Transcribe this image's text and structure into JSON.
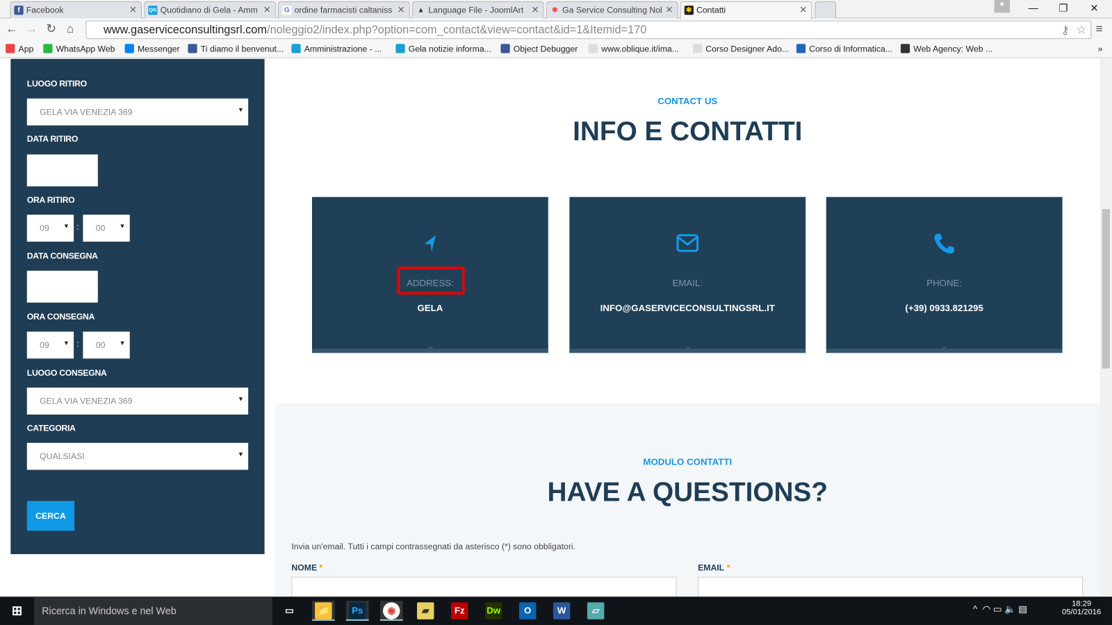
{
  "browser": {
    "tabs": [
      {
        "title": "Facebook",
        "fav": "f",
        "color": "#3b5998"
      },
      {
        "title": "Quotidiano di Gela - Amm",
        "fav": "QG",
        "color": "#1aa0d8"
      },
      {
        "title": "ordine farmacisti caltaniss",
        "fav": "G",
        "color": "#4285f4"
      },
      {
        "title": "Language File - JoomlArt",
        "fav": "▲",
        "color": "#333"
      },
      {
        "title": "Ga Service Consulting Nol",
        "fav": "✱",
        "color": "#e44"
      },
      {
        "title": "Contatti",
        "fav": "✱",
        "color": "#222"
      }
    ],
    "url_domain": "www.gaserviceconsultingsrl.com",
    "url_path": "/noleggio2/index.php?option=com_contact&view=contact&id=1&Itemid=170",
    "bookmarks": [
      {
        "label": "App",
        "color": "#e44"
      },
      {
        "label": "WhatsApp Web",
        "color": "#2db742"
      },
      {
        "label": "Messenger",
        "color": "#0084ff"
      },
      {
        "label": "Ti diamo il benvenut...",
        "color": "#3b5998"
      },
      {
        "label": "Amministrazione - ...",
        "color": "#1aa0d8"
      },
      {
        "label": "Gela notizie informa...",
        "color": "#1aa0d8"
      },
      {
        "label": "Object Debugger",
        "color": "#3b5998"
      },
      {
        "label": "www.oblique.it/ima...",
        "color": "#ddd"
      },
      {
        "label": "Corso Designer Ado...",
        "color": "#ddd"
      },
      {
        "label": "Corso di Informatica...",
        "color": "#2266bb"
      },
      {
        "label": "Web Agency: Web ...",
        "color": "#333"
      }
    ]
  },
  "sidebar": {
    "luogo_ritiro_label": "LUOGO RITIRO",
    "luogo_ritiro_value": "GELA VIA VENEZIA 369",
    "data_ritiro_label": "DATA RITIRO",
    "ora_ritiro_label": "ORA RITIRO",
    "ora_ritiro_h": "09",
    "ora_ritiro_m": "00",
    "data_consegna_label": "DATA CONSEGNA",
    "ora_consegna_label": "ORA CONSEGNA",
    "ora_consegna_h": "09",
    "ora_consegna_m": "00",
    "luogo_consegna_label": "LUOGO CONSEGNA",
    "luogo_consegna_value": "GELA VIA VENEZIA 369",
    "categoria_label": "CATEGORIA",
    "categoria_value": "QUALSIASI",
    "cerca": "CERCA",
    "colon": ":"
  },
  "contact": {
    "kicker": "CONTACT US",
    "title": "INFO E CONTATTI",
    "cards": [
      {
        "label": "ADDRESS:",
        "value": "GELA"
      },
      {
        "label": "EMAIL:",
        "value": "INFO@GASERVICECONSULTINGSRL.IT"
      },
      {
        "label": "PHONE:",
        "value": "(+39) 0933.821295"
      }
    ]
  },
  "form": {
    "kicker": "MODULO CONTATTI",
    "title": "HAVE A QUESTIONS?",
    "intro": "Invia un'email. Tutti i campi contrassegnati da asterisco (*) sono obbligatori.",
    "nome_label": "NOME",
    "email_label": "EMAIL",
    "required": "*"
  },
  "taskbar": {
    "search": "Ricerca in Windows e nel Web",
    "time": "18:29",
    "date": "05/01/2016",
    "apps": [
      "▭",
      "📁",
      "Ps",
      "◉",
      "▰",
      "Fz",
      "Dw",
      "O",
      "W",
      "▱"
    ]
  }
}
